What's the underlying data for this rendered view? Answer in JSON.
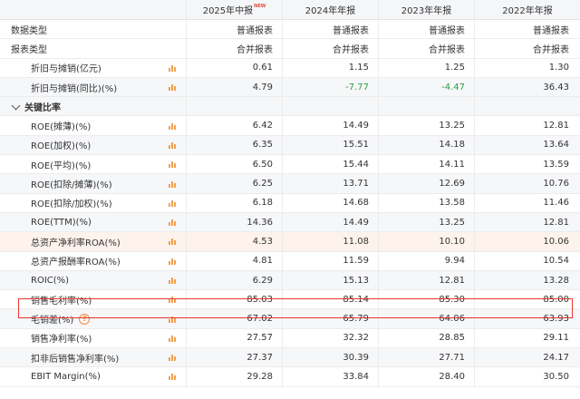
{
  "header": {
    "periods": [
      {
        "label": "2025年中报",
        "badge": "NEW"
      },
      {
        "label": "2024年年报"
      },
      {
        "label": "2023年年报"
      },
      {
        "label": "2022年年报"
      }
    ]
  },
  "rows_top": [
    {
      "label": "数据类型",
      "values": [
        "普通报表",
        "普通报表",
        "普通报表",
        "普通报表"
      ]
    },
    {
      "label": "报表类型",
      "values": [
        "合并报表",
        "合并报表",
        "合并报表",
        "合并报表"
      ]
    },
    {
      "label": "折旧与摊销(亿元)",
      "values": [
        "0.61",
        "1.15",
        "1.25",
        "1.30"
      ]
    },
    {
      "label": "折旧与摊销(同比)(%)",
      "values": [
        "4.79",
        "-7.77",
        "-4.47",
        "36.43"
      ]
    }
  ],
  "section": {
    "label": "关键比率"
  },
  "rows_ratio": [
    {
      "label": "ROE(摊薄)(%)",
      "values": [
        "6.42",
        "14.49",
        "13.25",
        "12.81"
      ]
    },
    {
      "label": "ROE(加权)(%)",
      "values": [
        "6.35",
        "15.51",
        "14.18",
        "13.64"
      ]
    },
    {
      "label": "ROE(平均)(%)",
      "values": [
        "6.50",
        "15.44",
        "14.11",
        "13.59"
      ]
    },
    {
      "label": "ROE(扣除/摊薄)(%)",
      "values": [
        "6.25",
        "13.71",
        "12.69",
        "10.76"
      ]
    },
    {
      "label": "ROE(扣除/加权)(%)",
      "values": [
        "6.18",
        "14.68",
        "13.58",
        "11.46"
      ]
    },
    {
      "label": "ROE(TTM)(%)",
      "values": [
        "14.36",
        "14.49",
        "13.25",
        "12.81"
      ]
    },
    {
      "label": "总资产净利率ROA(%)",
      "values": [
        "4.53",
        "11.08",
        "10.10",
        "10.06"
      ]
    },
    {
      "label": "总资产报酬率ROA(%)",
      "values": [
        "4.81",
        "11.59",
        "9.94",
        "10.54"
      ]
    },
    {
      "label": "ROIC(%)",
      "values": [
        "6.29",
        "15.13",
        "12.81",
        "13.28"
      ]
    },
    {
      "label": "销售毛利率(%)",
      "values": [
        "85.03",
        "85.14",
        "85.30",
        "85.00"
      ]
    },
    {
      "label": "毛销差(%)",
      "values": [
        "67.02",
        "65.79",
        "64.06",
        "63.93"
      ]
    },
    {
      "label": "销售净利率(%)",
      "values": [
        "27.57",
        "32.32",
        "28.85",
        "29.11"
      ]
    },
    {
      "label": "扣非后销售净利率(%)",
      "values": [
        "27.37",
        "30.39",
        "27.71",
        "24.17"
      ]
    },
    {
      "label": "EBIT Margin(%)",
      "values": [
        "29.28",
        "33.84",
        "28.40",
        "30.50"
      ]
    }
  ],
  "help_glyph": "?",
  "colors": {
    "negative": "#2e9e3e",
    "highlight_border": "#e8362b",
    "icon": "#f0a050",
    "new_badge": "#e84b3c"
  }
}
